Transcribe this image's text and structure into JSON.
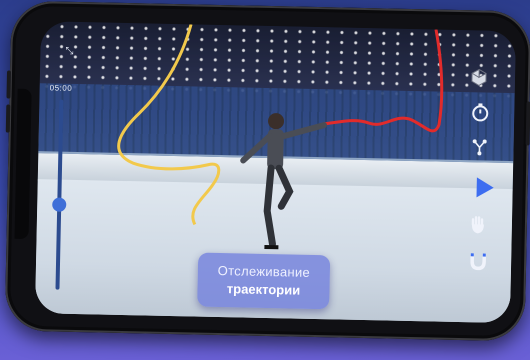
{
  "player": {
    "time": "05:00",
    "mode_label_line1": "Отслеживание",
    "mode_label_line2": "траектории",
    "playback_progress": 0.45
  },
  "controls": {
    "top_left_icon": "collapse-icon",
    "camera_icon": "cube-camera-icon",
    "timer_icon": "timer-icon",
    "tracking_icon": "trajectory-nodes-icon",
    "play_icon": "play-icon",
    "hand_icon": "hand-icon",
    "magnet_icon": "magnet-icon"
  },
  "colors": {
    "trajectory_left": "#f2c94c",
    "trajectory_right": "#e22b2b",
    "accent": "#3f6fd8"
  }
}
